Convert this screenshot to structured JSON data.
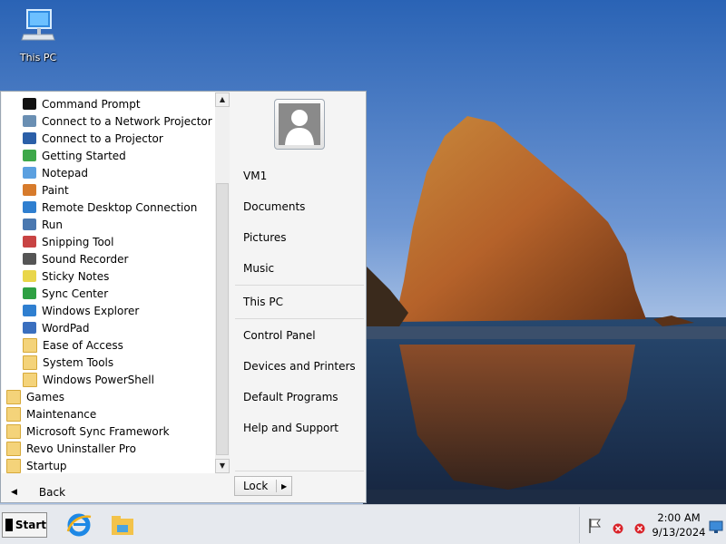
{
  "desktop": {
    "icons": [
      {
        "label": "This PC",
        "icon": "computer-icon"
      }
    ]
  },
  "start_menu": {
    "programs": [
      {
        "label": "Command Prompt",
        "icon": "command-prompt-icon",
        "indent": 1
      },
      {
        "label": "Connect to a Network Projector",
        "icon": "network-projector-icon",
        "indent": 1
      },
      {
        "label": "Connect to a Projector",
        "icon": "projector-icon",
        "indent": 1
      },
      {
        "label": "Getting Started",
        "icon": "getting-started-icon",
        "indent": 1
      },
      {
        "label": "Notepad",
        "icon": "notepad-icon",
        "indent": 1
      },
      {
        "label": "Paint",
        "icon": "paint-icon",
        "indent": 1
      },
      {
        "label": "Remote Desktop Connection",
        "icon": "remote-desktop-icon",
        "indent": 1
      },
      {
        "label": "Run",
        "icon": "run-icon",
        "indent": 1
      },
      {
        "label": "Snipping Tool",
        "icon": "snipping-tool-icon",
        "indent": 1
      },
      {
        "label": "Sound Recorder",
        "icon": "microphone-icon",
        "indent": 1
      },
      {
        "label": "Sticky Notes",
        "icon": "sticky-notes-icon",
        "indent": 1
      },
      {
        "label": "Sync Center",
        "icon": "sync-center-icon",
        "indent": 1
      },
      {
        "label": "Windows Explorer",
        "icon": "windows-explorer-icon",
        "indent": 1
      },
      {
        "label": "WordPad",
        "icon": "wordpad-icon",
        "indent": 1
      },
      {
        "label": "Ease of Access",
        "icon": "folder-icon",
        "indent": 1
      },
      {
        "label": "System Tools",
        "icon": "folder-icon",
        "indent": 1
      },
      {
        "label": "Windows PowerShell",
        "icon": "folder-icon",
        "indent": 1
      },
      {
        "label": "Games",
        "icon": "folder-icon",
        "indent": 0
      },
      {
        "label": "Maintenance",
        "icon": "folder-icon",
        "indent": 0
      },
      {
        "label": "Microsoft Sync Framework",
        "icon": "folder-icon",
        "indent": 0
      },
      {
        "label": "Revo Uninstaller Pro",
        "icon": "folder-icon",
        "indent": 0
      },
      {
        "label": "Startup",
        "icon": "folder-icon",
        "indent": 0
      }
    ],
    "back_label": "Back",
    "right_items": [
      {
        "label": "VM1",
        "name": "user-name-link"
      },
      {
        "label": "Documents",
        "name": "documents-link"
      },
      {
        "label": "Pictures",
        "name": "pictures-link"
      },
      {
        "label": "Music",
        "name": "music-link"
      },
      {
        "label": "This PC",
        "name": "this-pc-link"
      },
      {
        "label": "Control Panel",
        "name": "control-panel-link"
      },
      {
        "label": "Devices and Printers",
        "name": "devices-and-printers-link"
      },
      {
        "label": "Default Programs",
        "name": "default-programs-link"
      },
      {
        "label": "Help and Support",
        "name": "help-and-support-link"
      }
    ],
    "lock_label": "Lock"
  },
  "taskbar": {
    "start_label": "Start",
    "pinned": [
      {
        "name": "internet-explorer-icon"
      },
      {
        "name": "file-explorer-icon"
      }
    ],
    "tray": {
      "icons": [
        "action-center-flag-icon",
        "network-error-icon",
        "volume-error-icon"
      ],
      "time": "2:00 AM",
      "date": "9/13/2024"
    }
  },
  "colors": {
    "start_menu_bg": "#f4f4f4",
    "taskbar_bg": "#e6e9ee",
    "sky_top": "#2a63b5",
    "rock": "#b5622a"
  }
}
